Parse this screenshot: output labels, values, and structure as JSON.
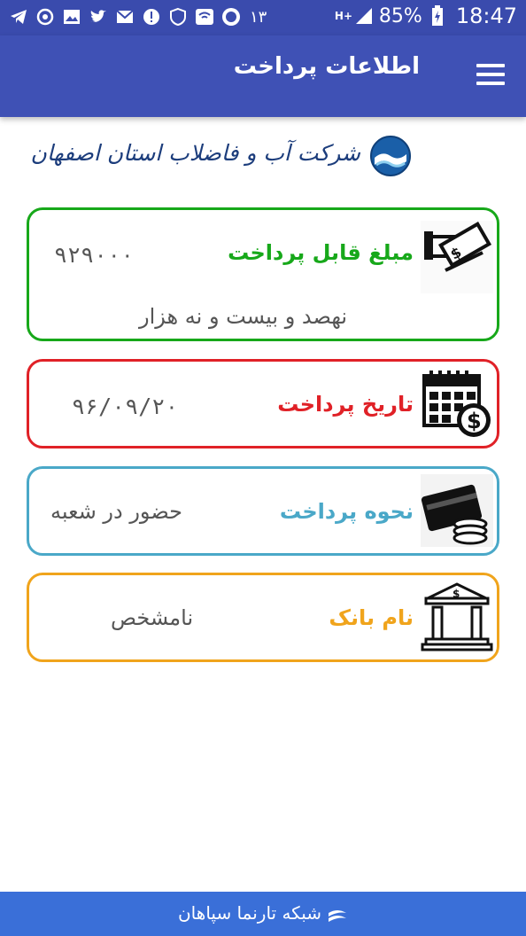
{
  "status_bar": {
    "notification_count": "۱۳",
    "battery_percent": "85%",
    "time": "18:47",
    "network_type": "H+"
  },
  "app_bar": {
    "title": "اطلاعات پرداخت",
    "menu_icon": "hamburger-menu-icon"
  },
  "logo": {
    "company_name": "شرکت آب و فاضلاب استان اصفهان",
    "emblem_icon": "water-wave-emblem-icon",
    "color": "#1c3d7c"
  },
  "cards": {
    "amount": {
      "label": "مبلغ قابل پرداخت",
      "value": "۹۲۹۰۰۰",
      "value_words": "نهصد و بیست و نه هزار",
      "icon": "cash-hand-icon",
      "accent": "#17a81a"
    },
    "date": {
      "label": "تاریخ پرداخت",
      "value": "۹۶/۰۹/۲۰",
      "icon": "calendar-dollar-icon",
      "accent": "#e02127"
    },
    "method": {
      "label": "نحوه پرداخت",
      "value": "حضور در شعبه",
      "icon": "card-coins-icon",
      "accent": "#4aa8c8"
    },
    "bank": {
      "label": "نام بانک",
      "value": "نامشخص",
      "icon": "bank-building-icon",
      "accent": "#f0a41c"
    }
  },
  "footer": {
    "text": "شبکه تارنما سپاهان",
    "icon": "sepahan-logo-icon",
    "color": "#3a6fd8"
  }
}
